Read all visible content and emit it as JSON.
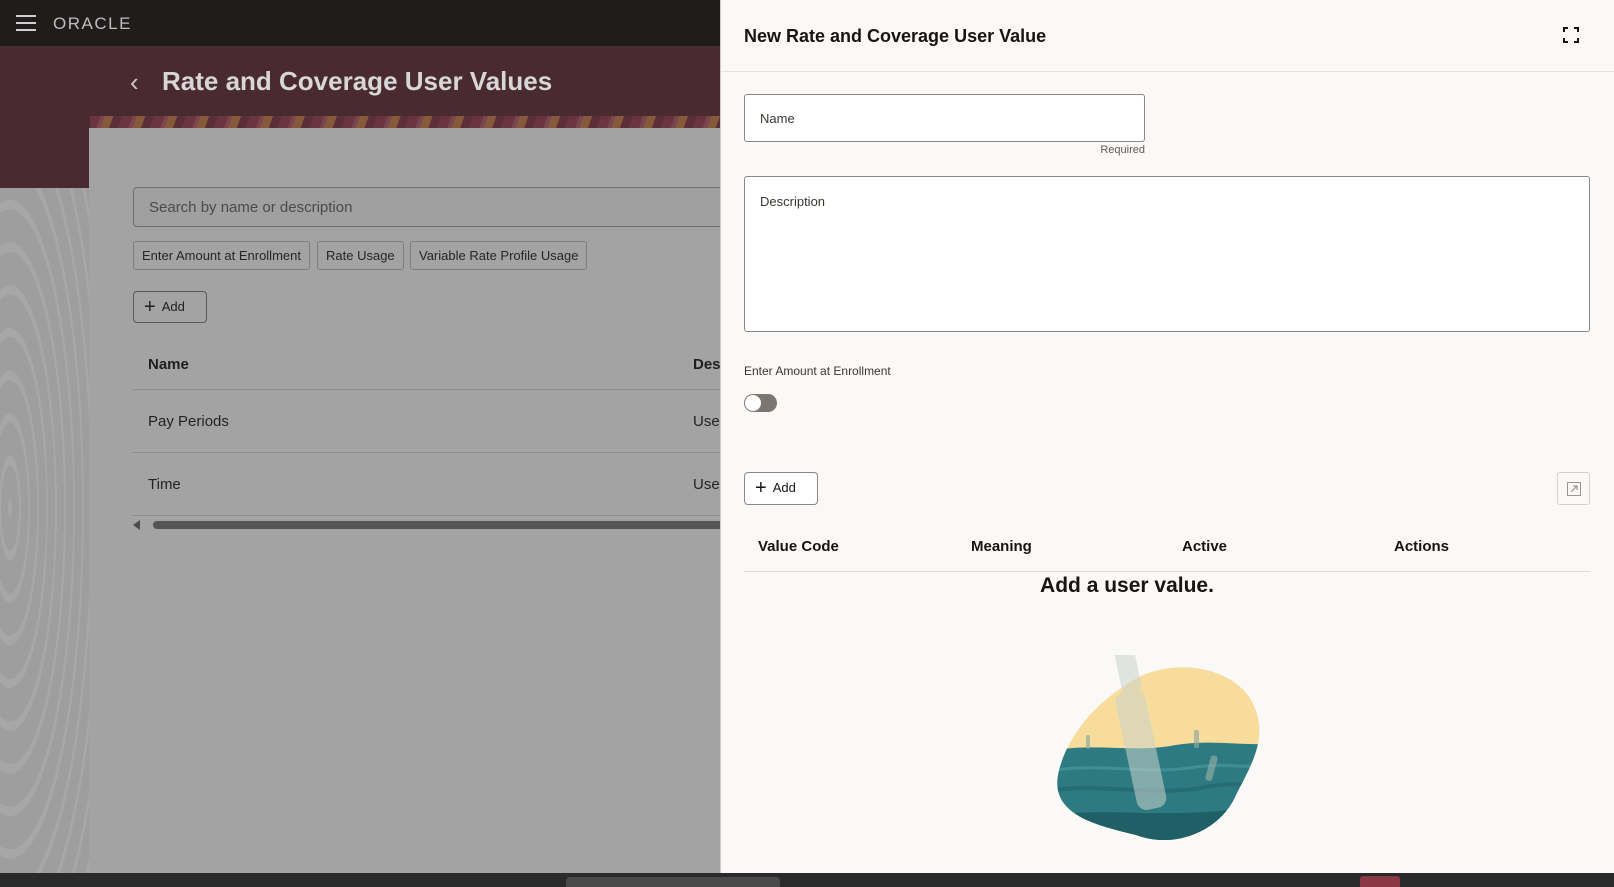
{
  "app": {
    "logo_text": "ORACLE",
    "page_title": "Rate and Coverage User Values"
  },
  "background": {
    "search_placeholder": "Search by name or description",
    "filter_chips": [
      "Enter Amount at Enrollment",
      "Rate Usage",
      "Variable Rate Profile Usage"
    ],
    "add_label": "Add",
    "columns": [
      "Name",
      "Des"
    ],
    "rows": [
      {
        "name": "Pay Periods",
        "description": "Use"
      },
      {
        "name": "Time",
        "description": "Use"
      }
    ]
  },
  "drawer": {
    "title": "New Rate and Coverage User Value",
    "name_label": "Name",
    "required_text": "Required",
    "description_label": "Description",
    "toggle_label": "Enter Amount at Enrollment",
    "toggle_on": false,
    "add_label": "Add",
    "columns": [
      "Value Code",
      "Meaning",
      "Active",
      "Actions"
    ],
    "empty_message": "Add a user value."
  },
  "colors": {
    "topbar": "#1f1c1b",
    "banner": "#4a2a31",
    "drawer_bg": "#fbf9f8",
    "illus_sky": "#f7dc9c",
    "illus_sea": "#2e7a82"
  }
}
